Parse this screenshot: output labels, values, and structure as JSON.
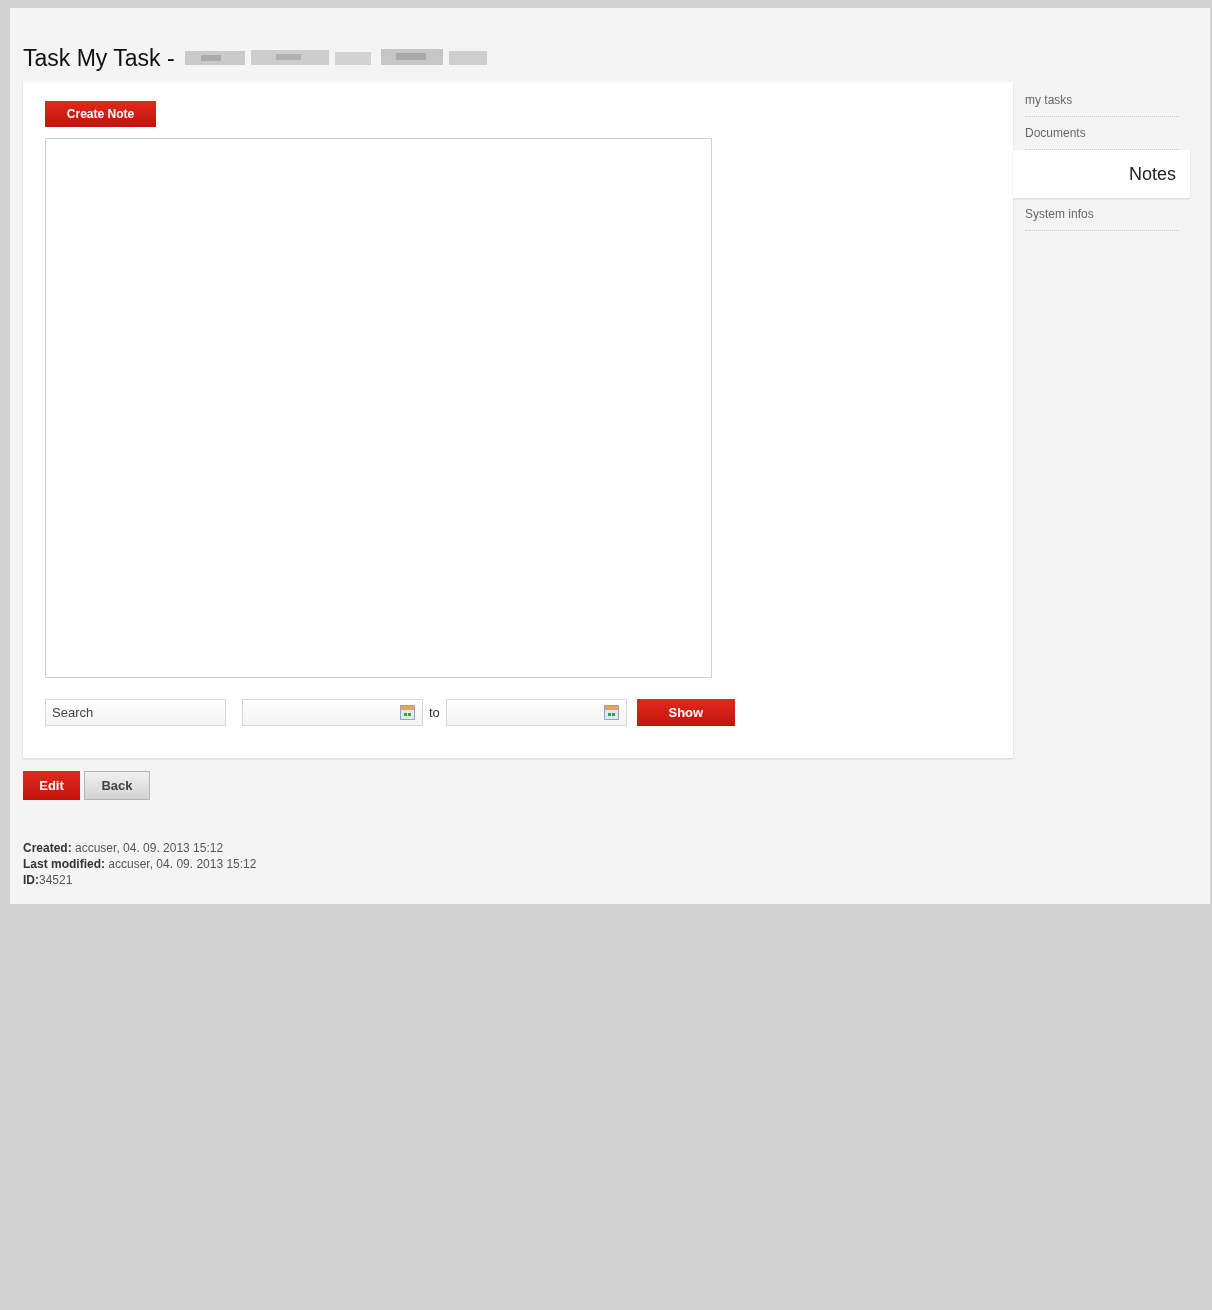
{
  "title": "Task My Task -",
  "create_button": "Create Note",
  "filter": {
    "search": {
      "placeholder": "Search"
    },
    "date_separator": "to",
    "show_button": "Show"
  },
  "actions": [
    "Edit",
    "Back"
  ],
  "sidebar": {
    "items": [
      {
        "label": "my tasks",
        "selected": false
      },
      {
        "label": "Documents",
        "selected": false
      },
      {
        "label": "Notes",
        "selected": true
      },
      {
        "label": "System infos",
        "selected": false
      }
    ]
  },
  "meta": [
    "**Created:** accuser, 04. 09. 2013 15:12",
    "**Last modified:** accuser, 04. 09. 2013 15:12",
    "**ID:**34521"
  ]
}
